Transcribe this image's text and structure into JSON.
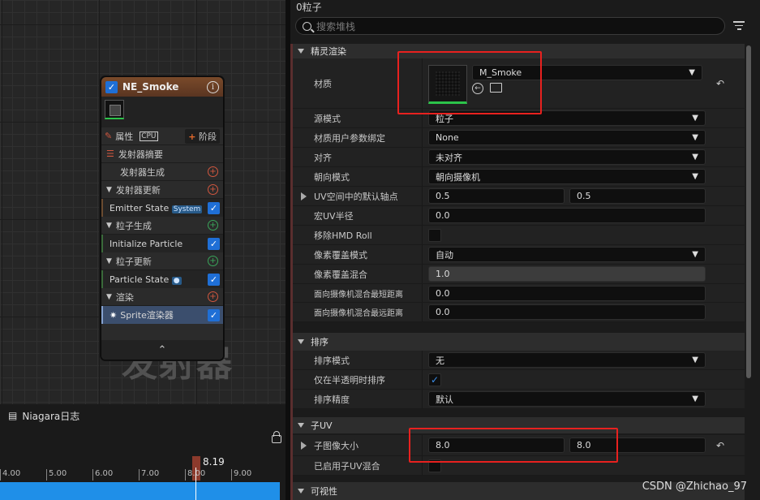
{
  "node": {
    "title": "NE_Smoke",
    "props_label": "属性",
    "cpu_tag": "CPU",
    "add_stage_label": "阶段",
    "summary_label": "发射器摘要",
    "stages": [
      {
        "label": "发射器生成"
      },
      {
        "label": "发射器更新"
      },
      {
        "label": "粒子生成"
      },
      {
        "label": "粒子更新"
      },
      {
        "label": "渲染"
      }
    ],
    "modules": {
      "emitter_state": "Emitter State",
      "emitter_state_tag": "System",
      "init_particle": "Initialize Particle",
      "particle_state": "Particle State",
      "sprite_renderer": "Sprite渲染器"
    }
  },
  "graph": {
    "watermark": "发射器"
  },
  "log": {
    "title": "Niagara日志"
  },
  "timeline": {
    "ticks": [
      "4.00",
      "5.00",
      "6.00",
      "7.00",
      "8.00",
      "9.00"
    ],
    "cursor_value": "8.19"
  },
  "panel": {
    "title": "0粒子",
    "search_placeholder": "搜索堆栈"
  },
  "details": {
    "sprite_category": "精灵渲染",
    "material_label": "材质",
    "material_value": "M_Smoke",
    "rows": {
      "source_mode": {
        "label": "源模式",
        "value": "粒子"
      },
      "mat_user_param": {
        "label": "材质用户参数绑定",
        "value": "None"
      },
      "alignment": {
        "label": "对齐",
        "value": "未对齐"
      },
      "facing": {
        "label": "朝向模式",
        "value": "朝向摄像机"
      },
      "pivot": {
        "label": "UV空间中的默认轴点",
        "x": "0.5",
        "y": "0.5"
      },
      "macro_uv": {
        "label": "宏UV半径",
        "value": "0.0"
      },
      "hmd_roll": {
        "label": "移除HMD Roll"
      },
      "pixel_cov_mode": {
        "label": "像素覆盖模式",
        "value": "自动"
      },
      "pixel_cov_blend": {
        "label": "像素覆盖混合",
        "value": "1.0"
      },
      "cam_min": {
        "label": "面向摄像机混合最短距离",
        "value": "0.0"
      },
      "cam_max": {
        "label": "面向摄像机混合最远距离",
        "value": "0.0"
      }
    },
    "sort_category": "排序",
    "sort_rows": {
      "sort_mode": {
        "label": "排序模式",
        "value": "无"
      },
      "translucent_only": {
        "label": "仅在半透明时排序"
      },
      "sort_precision": {
        "label": "排序精度",
        "value": "默认"
      }
    },
    "subuv_category": "子UV",
    "subuv_rows": {
      "sub_image_size": {
        "label": "子图像大小",
        "x": "8.0",
        "y": "8.0"
      },
      "subuv_blend": {
        "label": "已启用子UV混合"
      }
    },
    "visibility_category": "可视性"
  },
  "credit": "CSDN @Zhichao_97"
}
